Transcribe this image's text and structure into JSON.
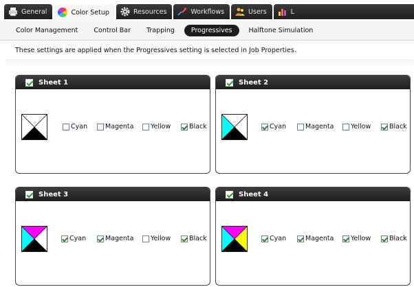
{
  "tabs": [
    {
      "label": "General",
      "icon": "printer-icon",
      "active": false
    },
    {
      "label": "Color Setup",
      "icon": "color-wheel-icon",
      "active": true
    },
    {
      "label": "Resources",
      "icon": "gear-icon",
      "active": false
    },
    {
      "label": "Workflows",
      "icon": "workflow-arrows-icon",
      "active": false
    },
    {
      "label": "Users",
      "icon": "users-icon",
      "active": false
    },
    {
      "label": "Logs",
      "icon": "bar-chart-icon",
      "active": false
    }
  ],
  "subnav": [
    {
      "label": "Color Management",
      "active": false
    },
    {
      "label": "Control Bar",
      "active": false
    },
    {
      "label": "Trapping",
      "active": false
    },
    {
      "label": "Progressives",
      "active": true
    },
    {
      "label": "Halftone Simulation",
      "active": false
    }
  ],
  "description": "These settings are applied when the Progressives setting is selected in Job Properties.",
  "option_labels": {
    "cyan": "Cyan",
    "magenta": "Magenta",
    "yellow": "Yellow",
    "black": "Black"
  },
  "colors": {
    "cyan": "#00ffff",
    "magenta": "#ff00ff",
    "yellow": "#ffff00",
    "black": "#000000",
    "white": "#ffffff"
  },
  "sheets": [
    {
      "title": "Sheet 1",
      "enabled": true,
      "cyan": false,
      "magenta": false,
      "yellow": false,
      "black": true
    },
    {
      "title": "Sheet 2",
      "enabled": true,
      "cyan": true,
      "magenta": false,
      "yellow": false,
      "black": true
    },
    {
      "title": "Sheet 3",
      "enabled": true,
      "cyan": true,
      "magenta": true,
      "yellow": false,
      "black": true
    },
    {
      "title": "Sheet 4",
      "enabled": true,
      "cyan": true,
      "magenta": true,
      "yellow": true,
      "black": true
    }
  ]
}
